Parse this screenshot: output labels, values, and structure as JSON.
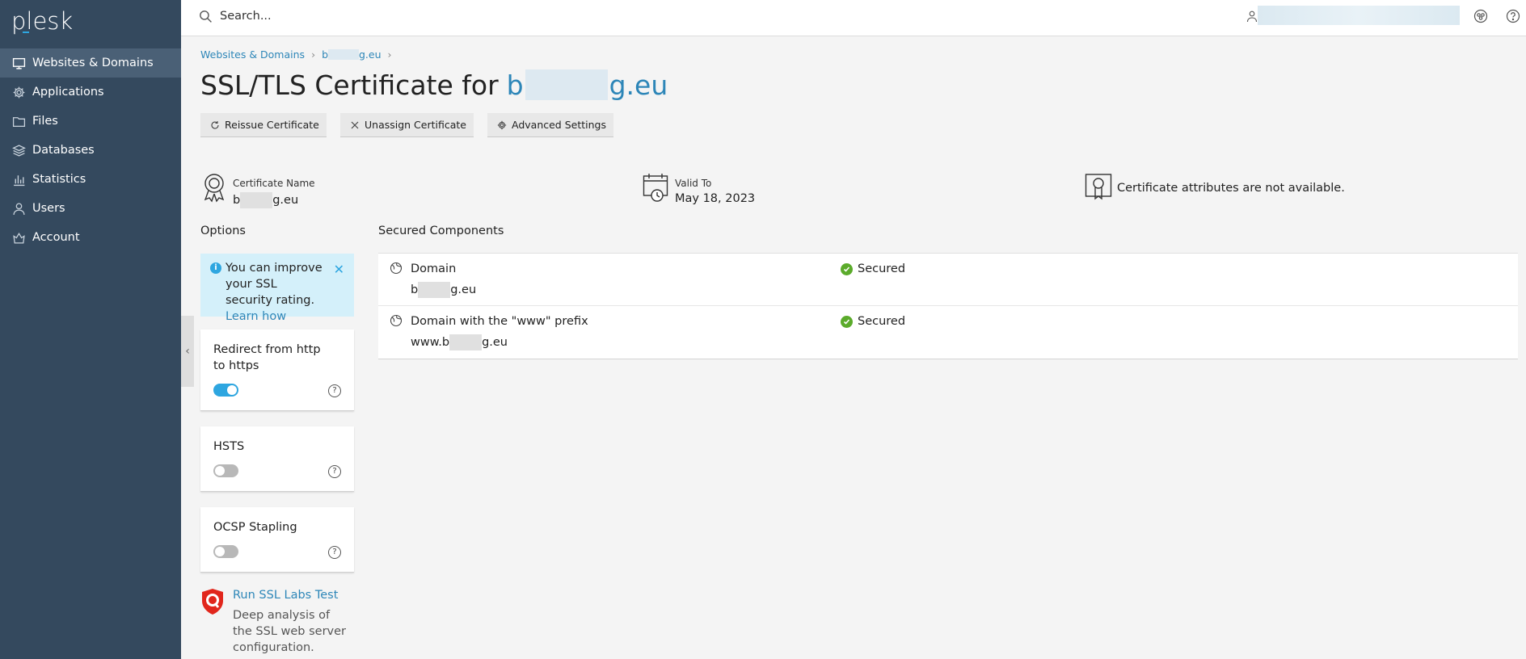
{
  "sidebar": {
    "logo": "plesk",
    "items": [
      {
        "label": "Websites & Domains",
        "icon": "monitor-icon",
        "active": true
      },
      {
        "label": "Applications",
        "icon": "gear-icon"
      },
      {
        "label": "Files",
        "icon": "folder-icon"
      },
      {
        "label": "Databases",
        "icon": "layers-icon"
      },
      {
        "label": "Statistics",
        "icon": "bar-chart-icon"
      },
      {
        "label": "Users",
        "icon": "user-icon"
      },
      {
        "label": "Account",
        "icon": "account-icon"
      }
    ]
  },
  "topbar": {
    "search_placeholder": "Search..."
  },
  "breadcrumb": {
    "root": "Websites & Domains",
    "domain_prefix": "b",
    "domain_suffix": "g.eu"
  },
  "title": {
    "text": "SSL/TLS Certificate for",
    "domain_prefix": "b",
    "domain_suffix": "g.eu"
  },
  "toolbar": {
    "reissue": "Reissue Certificate",
    "unassign": "Unassign Certificate",
    "advanced": "Advanced Settings"
  },
  "certificate": {
    "name_label": "Certificate Name",
    "name_prefix": "b",
    "name_suffix": "g.eu",
    "valid_label": "Valid To",
    "valid_value": "May 18, 2023",
    "attributes_text": "Certificate attributes are not available."
  },
  "options": {
    "heading": "Options",
    "notice": {
      "text": "You can improve your SSL security rating.",
      "link": "Learn how"
    },
    "items": [
      {
        "label": "Redirect from http to https",
        "enabled": true
      },
      {
        "label": "HSTS",
        "enabled": false
      },
      {
        "label": "OCSP Stapling",
        "enabled": false
      }
    ],
    "ssllabs": {
      "link": "Run SSL Labs Test",
      "desc": "Deep analysis of the SSL web server configuration."
    }
  },
  "components": {
    "heading": "Secured Components",
    "rows": [
      {
        "name": "Domain",
        "domain_prefix": "b",
        "domain_suffix": "g.eu",
        "status": "Secured"
      },
      {
        "name": "Domain with the \"www\" prefix",
        "domain_prefix": "www.b",
        "domain_suffix": "g.eu",
        "status": "Secured"
      }
    ]
  },
  "colors": {
    "sidebar_bg": "#34495e",
    "sidebar_active": "#4a6076",
    "accent": "#2ea6e0",
    "link": "#2d86b8",
    "success": "#5bab2b"
  }
}
